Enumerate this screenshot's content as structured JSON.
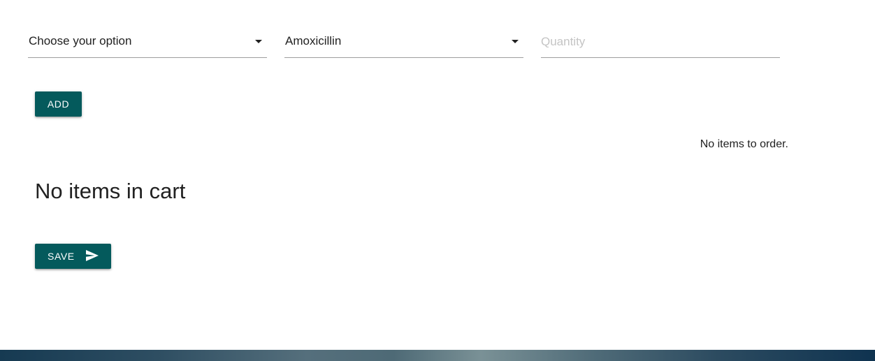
{
  "form": {
    "option_select": {
      "value": "Choose your option"
    },
    "drug_select": {
      "value": "Amoxicillin"
    },
    "quantity_input": {
      "value": "",
      "placeholder": "Quantity"
    },
    "add_label": "ADD"
  },
  "order": {
    "empty_message": "No items to order."
  },
  "cart": {
    "empty_heading": "No items in cart"
  },
  "save_label": "SAVE",
  "icons": {
    "option_caret": "caret-down-icon",
    "drug_caret": "caret-down-icon",
    "save_icon": "send-icon"
  },
  "colors": {
    "button_bg": "#045a5c",
    "button_text": "#ffffff",
    "field_underline": "#9e9e9e",
    "placeholder": "#c4c4c4"
  }
}
